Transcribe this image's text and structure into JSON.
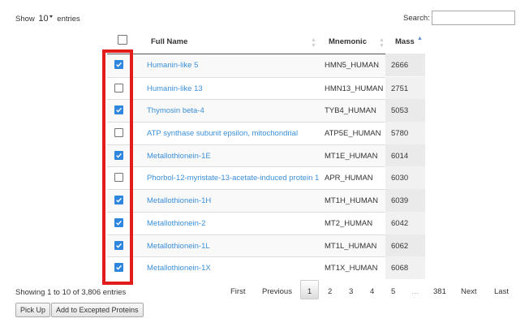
{
  "length_menu": {
    "prefix": "Show",
    "selected": "10",
    "suffix": "entries"
  },
  "search": {
    "label": "Search:",
    "value": ""
  },
  "table": {
    "columns": {
      "full_name": "Full Name",
      "mnemonic": "Mnemonic",
      "mass": "Mass"
    },
    "rows": [
      {
        "checked": true,
        "full_name": "Humanin-like 5",
        "mnemonic": "HMN5_HUMAN",
        "mass": "2666"
      },
      {
        "checked": false,
        "full_name": "Humanin-like 13",
        "mnemonic": "HMN13_HUMAN",
        "mass": "2751"
      },
      {
        "checked": true,
        "full_name": "Thymosin beta-4",
        "mnemonic": "TYB4_HUMAN",
        "mass": "5053"
      },
      {
        "checked": false,
        "full_name": "ATP synthase subunit epsilon, mitochondrial",
        "mnemonic": "ATP5E_HUMAN",
        "mass": "5780"
      },
      {
        "checked": true,
        "full_name": "Metallothionein-1E",
        "mnemonic": "MT1E_HUMAN",
        "mass": "6014"
      },
      {
        "checked": false,
        "full_name": "Phorbol-12-myristate-13-acetate-induced protein 1",
        "mnemonic": "APR_HUMAN",
        "mass": "6030"
      },
      {
        "checked": true,
        "full_name": "Metallothionein-1H",
        "mnemonic": "MT1H_HUMAN",
        "mass": "6039"
      },
      {
        "checked": true,
        "full_name": "Metallothionein-2",
        "mnemonic": "MT2_HUMAN",
        "mass": "6042"
      },
      {
        "checked": true,
        "full_name": "Metallothionein-1L",
        "mnemonic": "MT1L_HUMAN",
        "mass": "6062"
      },
      {
        "checked": true,
        "full_name": "Metallothionein-1X",
        "mnemonic": "MT1X_HUMAN",
        "mass": "6068"
      }
    ]
  },
  "info": "Showing 1 to 10 of 3,806 entries",
  "pagination": {
    "first": "First",
    "previous": "Previous",
    "pages": [
      "1",
      "2",
      "3",
      "4",
      "5"
    ],
    "ellipsis": "…",
    "last_page": "381",
    "next": "Next",
    "last": "Last",
    "current": "1"
  },
  "buttons": {
    "pick_up": "Pick Up",
    "add_excepted": "Add to Excepted Proteins"
  },
  "colors": {
    "link": "#3a8fd9",
    "checkbox": "#2e86de",
    "highlight": "#e21b1b"
  }
}
